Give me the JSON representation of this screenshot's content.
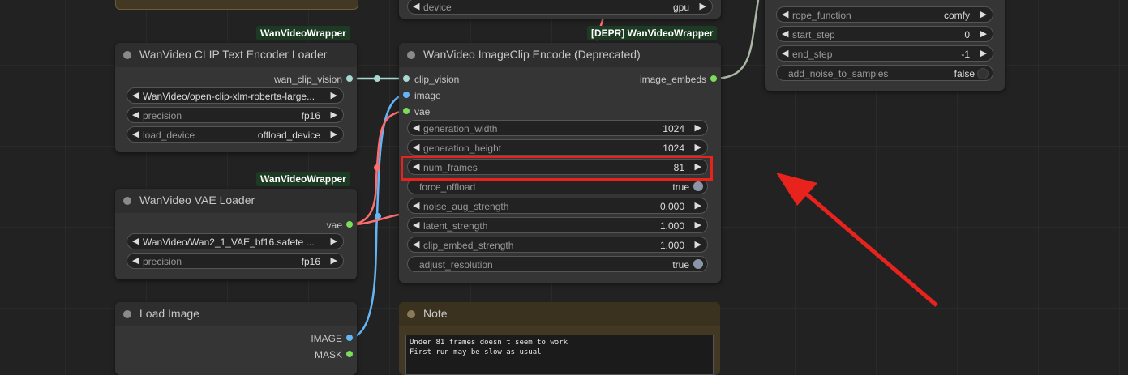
{
  "colors": {
    "canvas": "#222222",
    "node_bg": "#353535",
    "badge_bg": "#1d3b22",
    "note_bg": "#433824",
    "highlight": "#e8221c",
    "clip_vision": "#a8d9d0",
    "image": "#64b5f6",
    "vae": "#ff6e6e",
    "vae_dot": "#7cdc5b"
  },
  "clip_loader": {
    "badge": "WanVideoWrapper",
    "title": "WanVideo CLIP Text Encoder Loader",
    "output": "wan_clip_vision",
    "model": "WanVideo/open-clip-xlm-roberta-large...",
    "precision_label": "precision",
    "precision_value": "fp16",
    "load_device_label": "load_device",
    "load_device_value": "offload_device"
  },
  "vae_loader": {
    "badge": "WanVideoWrapper",
    "title": "WanVideo VAE Loader",
    "output": "vae",
    "model": "WanVideo/Wan2_1_VAE_bf16.safete ...",
    "precision_label": "precision",
    "precision_value": "fp16"
  },
  "load_image": {
    "title": "Load Image",
    "output_image": "IMAGE",
    "output_mask": "MASK"
  },
  "encode": {
    "badge": "[DEPR] WanVideoWrapper",
    "title": "WanVideo ImageClip Encode (Deprecated)",
    "input_clip": "clip_vision",
    "input_image": "image",
    "input_vae": "vae",
    "output": "image_embeds",
    "widgets": [
      {
        "label": "generation_width",
        "value": "1024"
      },
      {
        "label": "generation_height",
        "value": "1024"
      },
      {
        "label": "num_frames",
        "value": "81"
      },
      {
        "label": "noise_aug_strength",
        "value": "0.000"
      },
      {
        "label": "latent_strength",
        "value": "1.000"
      },
      {
        "label": "clip_embed_strength",
        "value": "1.000"
      }
    ],
    "force_offload_label": "force_offload",
    "force_offload_value": "true",
    "adjust_resolution_label": "adjust_resolution",
    "adjust_resolution_value": "true"
  },
  "top_node": {
    "device_label": "device",
    "device_value": "gpu"
  },
  "right_node": {
    "widgets": [
      {
        "label": "rope_function",
        "value": "comfy"
      },
      {
        "label": "start_step",
        "value": "0"
      },
      {
        "label": "end_step",
        "value": "-1"
      }
    ],
    "add_noise_label": "add_noise_to_samples",
    "add_noise_value": "false"
  },
  "note": {
    "title": "Note",
    "line1": "Under 81 frames doesn't seem to work",
    "line2": "First run may be slow as usual"
  }
}
